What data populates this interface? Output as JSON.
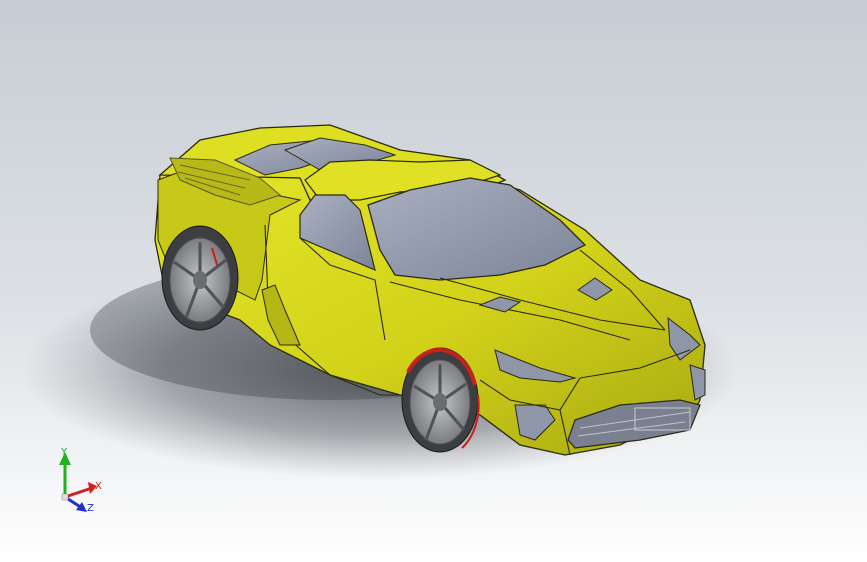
{
  "viewport": {
    "background_top": "#c7cdd4",
    "background_bottom": "#ffffff"
  },
  "model": {
    "body_color": "#d2d21a",
    "glass_color": "#8e96a8",
    "tire_color": "#3c3e42",
    "rim_color": "#9a9ca0",
    "brake_color": "#c8201a",
    "edge_color": "#2a2a10"
  },
  "triad": {
    "x_label": "X",
    "y_label": "Y",
    "z_label": "Z",
    "x_color": "#d02020",
    "y_color": "#20b020",
    "z_color": "#2030d0"
  }
}
